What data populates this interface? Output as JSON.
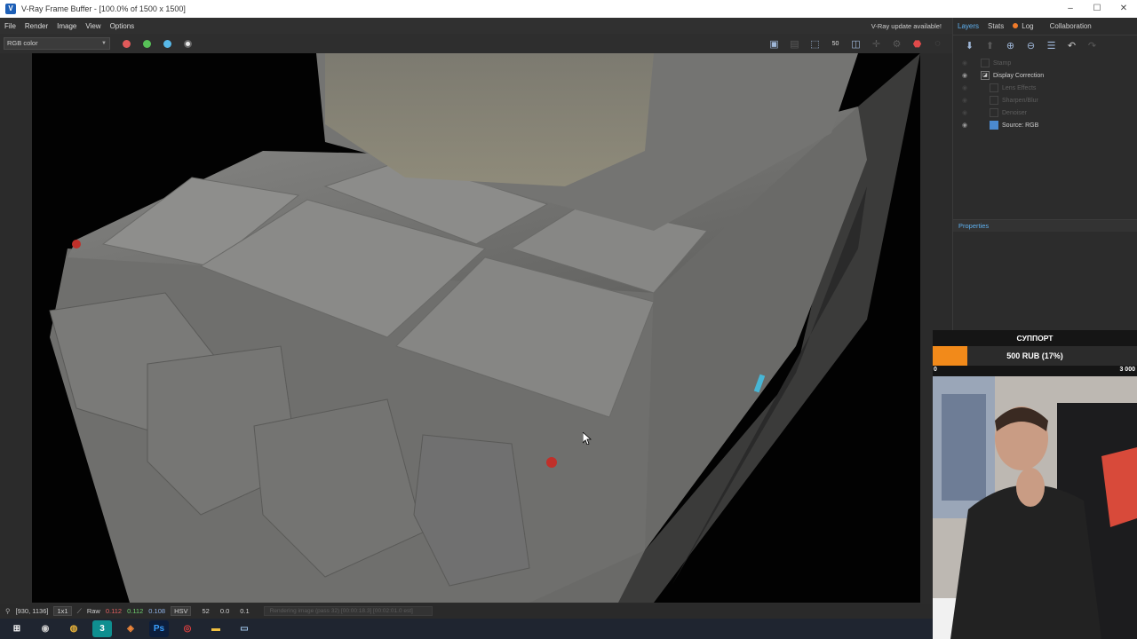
{
  "window": {
    "title": "V-Ray Frame Buffer - [100.0% of 1500 x 1500]",
    "controls": [
      "–",
      "☐",
      "✕"
    ]
  },
  "menu": {
    "items": [
      "File",
      "Render",
      "Image",
      "View",
      "Options"
    ],
    "update_note": "V-Ray update available!"
  },
  "toolbar": {
    "channel": "RGB color",
    "channel_dots": [
      "#e05a5a",
      "#58c158",
      "#58b8e8"
    ],
    "icons": [
      "save-icon",
      "save-all-icon",
      "region-icon",
      "zoom-50-icon",
      "fit-icon",
      "track-icon",
      "link-icon",
      "render-icon",
      "stop-icon"
    ]
  },
  "status": {
    "coords": "[930, 1136]",
    "zoom": "1x1",
    "mode": "Raw",
    "r": "0.112",
    "g": "0.112",
    "b": "0.108",
    "color_space": "HSV",
    "h": "52",
    "s": "0.0",
    "v": "0.1",
    "progress_text": "Rendering image (pass 32) [00:00:18.3] [00:02:01.0 est]"
  },
  "panel": {
    "tabs": [
      "Layers",
      "Stats",
      "Log",
      "Collaboration"
    ],
    "layers": [
      {
        "name": "Stamp",
        "visible": false,
        "enabled": false
      },
      {
        "name": "Display Correction",
        "visible": true,
        "enabled": true
      },
      {
        "name": "Lens Effects",
        "visible": false,
        "enabled": false
      },
      {
        "name": "Sharpen/Blur",
        "visible": false,
        "enabled": false
      },
      {
        "name": "Denoiser",
        "visible": false,
        "enabled": false
      },
      {
        "name": "Source: RGB",
        "visible": true,
        "enabled": true
      }
    ],
    "properties_label": "Properties"
  },
  "support": {
    "title": "СУППОРТ",
    "amount": "500 RUB (17%)",
    "progress_fraction": 0.17,
    "min": "0",
    "max": "3 000"
  },
  "taskbar": {
    "icons": [
      "windows-icon",
      "obs-icon",
      "chrome-icon",
      "3dsmax-icon",
      "blender-icon",
      "photoshop-icon",
      "davinci-icon",
      "explorer-icon",
      "vfb-icon"
    ]
  },
  "colors": {
    "accent": "#5fb1f0",
    "support_fill": "#f28a1a"
  }
}
